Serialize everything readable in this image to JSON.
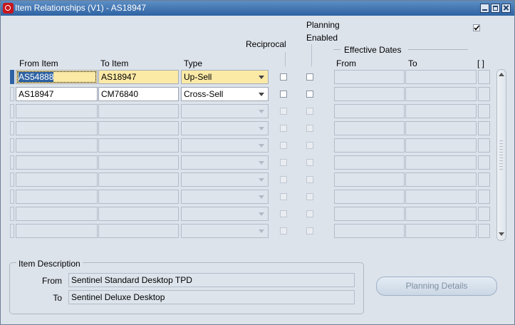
{
  "window": {
    "title": "Item Relationships (V1) - AS18947"
  },
  "headers": {
    "from_item": "From Item",
    "to_item": "To Item",
    "type": "Type",
    "reciprocal": "Reciprocal",
    "planning_enabled_line1": "Planning",
    "planning_enabled_line2": "Enabled",
    "effective_dates": "Effective Dates",
    "eff_from": "From",
    "eff_to": "To",
    "brackets": "[ ]"
  },
  "top_checkbox_checked": true,
  "rows": [
    {
      "from_item": "AS54888",
      "to_item": "AS18947",
      "type": "Up-Sell",
      "active": true,
      "reciprocal": false,
      "planning_enabled": false
    },
    {
      "from_item": "AS18947",
      "to_item": "CM76840",
      "type": "Cross-Sell",
      "active": false,
      "reciprocal": false,
      "planning_enabled": false
    },
    {
      "from_item": "",
      "to_item": "",
      "type": ""
    },
    {
      "from_item": "",
      "to_item": "",
      "type": ""
    },
    {
      "from_item": "",
      "to_item": "",
      "type": ""
    },
    {
      "from_item": "",
      "to_item": "",
      "type": ""
    },
    {
      "from_item": "",
      "to_item": "",
      "type": ""
    },
    {
      "from_item": "",
      "to_item": "",
      "type": ""
    },
    {
      "from_item": "",
      "to_item": "",
      "type": ""
    },
    {
      "from_item": "",
      "to_item": "",
      "type": ""
    }
  ],
  "lov_glyph": "...",
  "item_description": {
    "legend": "Item Description",
    "from_label": "From",
    "from_value": "Sentinel Standard Desktop TPD",
    "to_label": "To",
    "to_value": "Sentinel Deluxe Desktop"
  },
  "planning_details_button": "Planning Details"
}
